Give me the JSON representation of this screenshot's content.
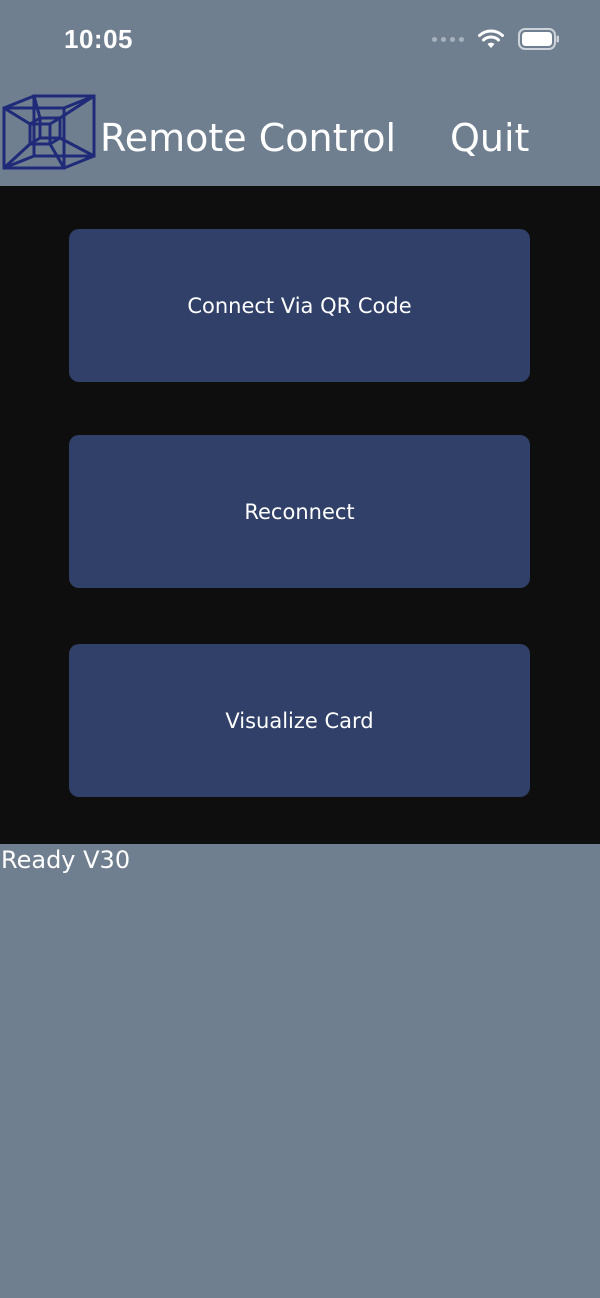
{
  "status_bar": {
    "time": "10:05",
    "icons": [
      "signal-dots-icon",
      "wifi-icon",
      "battery-icon"
    ]
  },
  "header": {
    "logo_icon": "wireframe-tesseract-logo-icon",
    "title": "Remote Control",
    "quit_label": "Quit"
  },
  "actions": [
    {
      "label": "Connect Via QR Code"
    },
    {
      "label": "Reconnect"
    },
    {
      "label": "Visualize Card"
    }
  ],
  "status": {
    "text": "Ready V30"
  },
  "colors": {
    "background": "#6f7f90",
    "panel": "#0e0e0e",
    "button": "#304069",
    "text": "#ffffff",
    "logo": "#1f2a78"
  }
}
